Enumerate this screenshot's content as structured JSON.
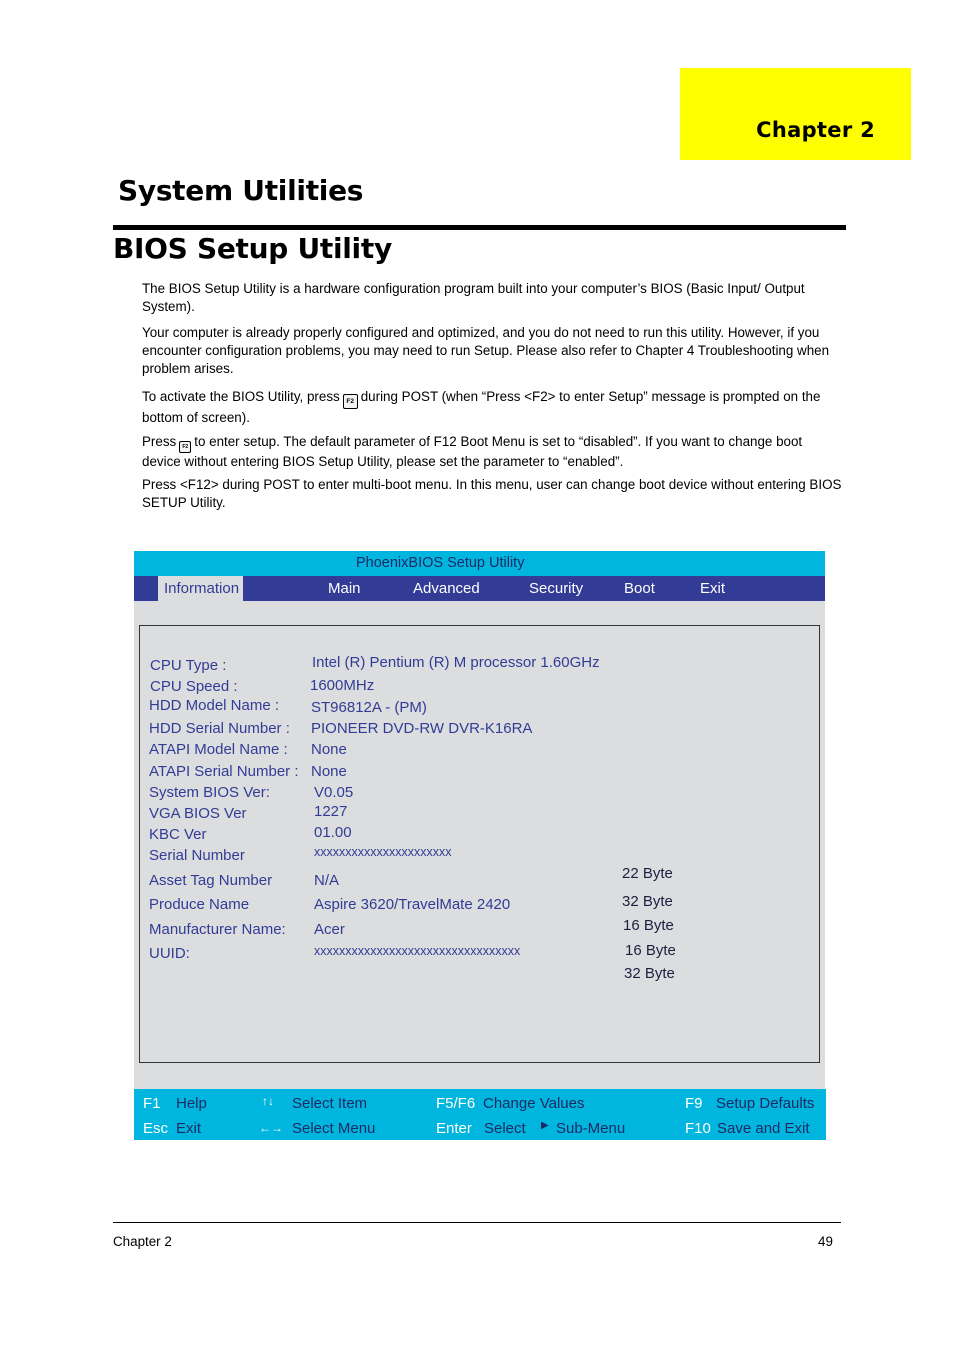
{
  "chapter_tab": {
    "label": "Chapter  2",
    "color": "#ffff00"
  },
  "section_title": "System Utilities",
  "page_heading": "BIOS Setup Utility",
  "paragraphs": {
    "p1": "The BIOS Setup Utility is a hardware configuration program built into your computer’s BIOS (Basic Input/ Output System).",
    "p2": "Your computer is already properly configured and optimized, and you do not need to run this utility. However, if you encounter configuration problems, you may need to run Setup.  Please also refer to Chapter 4 Troubleshooting when problem arises.",
    "p3_before": "To activate the BIOS Utility, press",
    "p3_after": "during POST (when “Press <F2> to enter Setup” message is prompted on the bottom of screen).",
    "p4_before": "Press",
    "p4_after": "to enter setup. The default parameter of F12 Boot Menu is set to “disabled”. If you want to change boot device without entering BIOS Setup Utility, please set the parameter to “enabled”.",
    "p5": "Press <F12> during POST to enter multi-boot menu. In this menu, user can change boot device without entering BIOS SETUP Utility.",
    "key_icon_label": "F2"
  },
  "bios": {
    "title": "PhoenixBIOS Setup Utility",
    "colors": {
      "title_bar": "#00b6de",
      "menu_bar": "#323c96",
      "panel": "#dcdddf",
      "text": "#323c96"
    },
    "menu": [
      {
        "label": "Information",
        "active": true
      },
      {
        "label": "Main",
        "active": false
      },
      {
        "label": "Advanced",
        "active": false
      },
      {
        "label": "Security",
        "active": false
      },
      {
        "label": "Boot",
        "active": false
      },
      {
        "label": "Exit",
        "active": false
      }
    ],
    "fields": [
      {
        "label": "CPU Type :",
        "value": "Intel (R) Pentium (R) M processor 1.60GHz"
      },
      {
        "label": "CPU Speed :",
        "value": "1600MHz"
      },
      {
        "label": "HDD Model Name :",
        "value": "ST96812A - (PM)"
      },
      {
        "label": "HDD Serial Number :",
        "value": "PIONEER DVD-RW DVR-K16RA"
      },
      {
        "label": "ATAPI Model Name :",
        "value": "None"
      },
      {
        "label": "ATAPI Serial Number :",
        "value": "None"
      },
      {
        "label": "System BIOS Ver:",
        "value": "V0.05"
      },
      {
        "label": "VGA BIOS Ver",
        "value": "1227"
      },
      {
        "label": "KBC Ver",
        "value": "01.00"
      },
      {
        "label": "Serial Number",
        "value": "xxxxxxxxxxxxxxxxxxxxxx"
      },
      {
        "label": "Asset Tag Number",
        "value": "N/A"
      },
      {
        "label": "Produce Name",
        "value": "Aspire 3620/TravelMate 2420"
      },
      {
        "label": "Manufacturer Name:",
        "value": "Acer"
      },
      {
        "label": "UUID:",
        "value": "xxxxxxxxxxxxxxxxxxxxxxxxxxxxxxxxx"
      }
    ],
    "byte_sizes": [
      "22 Byte",
      "32 Byte",
      "16 Byte",
      "16 Byte",
      "32 Byte"
    ],
    "footer": [
      {
        "key": "F1",
        "desc": "Help"
      },
      {
        "key": "Esc",
        "desc": "Exit"
      },
      {
        "key": "↑↓",
        "desc": "Select Item"
      },
      {
        "key": "←→",
        "desc": "Select Menu"
      },
      {
        "key": "F5/F6",
        "desc": "Change Values"
      },
      {
        "key": "Enter",
        "desc": "Select"
      },
      {
        "key": "▶",
        "desc": "Sub-Menu"
      },
      {
        "key": "F9",
        "desc": "Setup Defaults"
      },
      {
        "key": "F10",
        "desc": "Save and Exit"
      }
    ]
  },
  "footer": {
    "left": "Chapter 2",
    "page_number": "49"
  }
}
